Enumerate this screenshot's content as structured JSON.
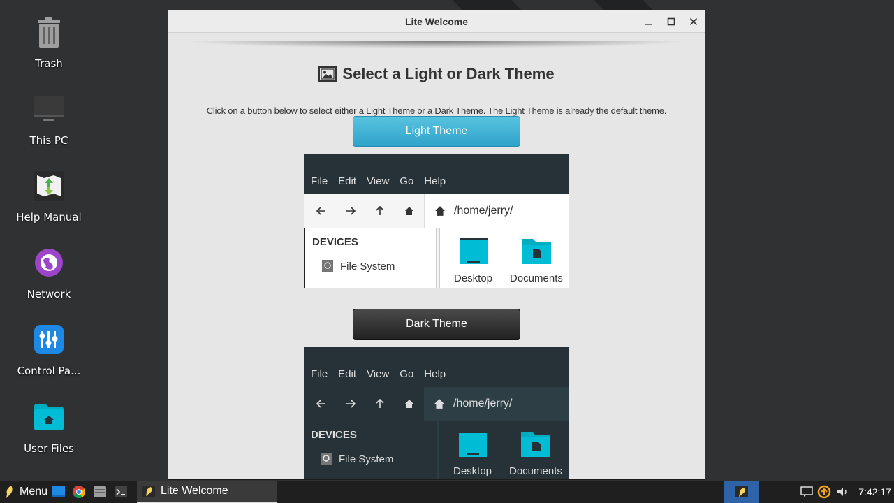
{
  "desktop": {
    "icons": [
      {
        "label": "Trash",
        "icon": "trash-icon"
      },
      {
        "label": "This PC",
        "icon": "computer-icon"
      },
      {
        "label": "Help Manual",
        "icon": "help-manual-icon"
      },
      {
        "label": "Network",
        "icon": "network-icon"
      },
      {
        "label": "Control Pa...",
        "icon": "control-panel-icon"
      },
      {
        "label": "User Files",
        "icon": "home-folder-icon"
      }
    ]
  },
  "window": {
    "title": "Lite Welcome",
    "heading": "Select a Light or Dark Theme",
    "description": "Click on a button below to select either a Light Theme or a Dark Theme. The Light Theme is already the default theme.",
    "light_button": "Light Theme",
    "dark_button": "Dark Theme",
    "preview": {
      "menu": [
        "File",
        "Edit",
        "View",
        "Go",
        "Help"
      ],
      "path": "/home/jerry/",
      "devices_label": "DEVICES",
      "device_item": "File System",
      "files": [
        "Desktop",
        "Documents"
      ]
    }
  },
  "taskbar": {
    "menu_label": "Menu",
    "active_task": "Lite Welcome",
    "clock": "7:42:17"
  },
  "colors": {
    "accent_light": "#2fa3c9",
    "dark_button": "#222222",
    "folder": "#00bcd4"
  }
}
